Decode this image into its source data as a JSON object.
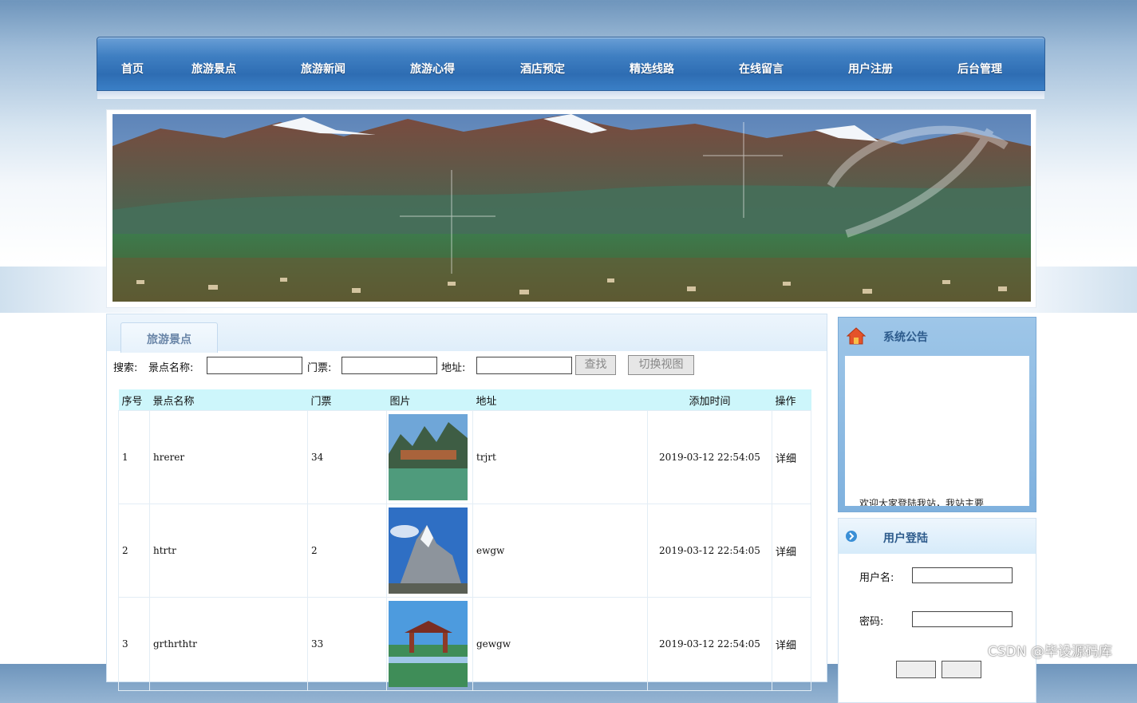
{
  "nav": {
    "items": [
      "首页",
      "旅游景点",
      "旅游新闻",
      "旅游心得",
      "酒店预定",
      "精选线路",
      "在线留言",
      "用户注册",
      "后台管理"
    ]
  },
  "main": {
    "tab_label": "旅游景点",
    "search": {
      "prefix": "搜索:",
      "name_label": "景点名称:",
      "ticket_label": "门票:",
      "address_label": "地址:",
      "find_button": "查找",
      "switch_button": "切换视图"
    },
    "table": {
      "headers": [
        "序号",
        "景点名称",
        "门票",
        "图片",
        "地址",
        "添加时间",
        "操作"
      ],
      "rows": [
        {
          "no": "1",
          "name": "hrerer",
          "ticket": "34",
          "address": "trjrt",
          "time": "2019-03-12 22:54:05",
          "op": "详细"
        },
        {
          "no": "2",
          "name": "htrtr",
          "ticket": "2",
          "address": "ewgw",
          "time": "2019-03-12 22:54:05",
          "op": "详细"
        },
        {
          "no": "3",
          "name": "grthrthtr",
          "ticket": "33",
          "address": "gewgw",
          "time": "2019-03-12 22:54:05",
          "op": "详细"
        }
      ]
    }
  },
  "notice": {
    "title": "系统公告",
    "text": "欢迎大家登陆我站，我站主要"
  },
  "login": {
    "title": "用户登陆",
    "username_label": "用户名:",
    "password_label": "密码:"
  },
  "watermark": "CSDN @毕设源码库",
  "colors": {
    "nav_blue": "#3f7fc2",
    "table_header": "#cdf6fb",
    "panel_border": "#7aaad6"
  }
}
